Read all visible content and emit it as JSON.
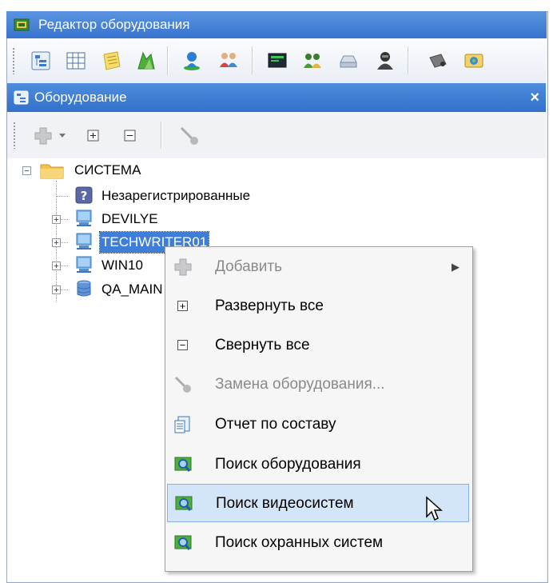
{
  "window": {
    "title": "Редактор оборудования"
  },
  "toolbar": {
    "buttons": [
      {
        "name": "tree-view-icon",
        "color": "#3a7bd5"
      },
      {
        "name": "grid-view-icon",
        "color": "#4a6fa8"
      },
      {
        "name": "notes-icon",
        "color": "#e8c84a"
      },
      {
        "name": "route-icon",
        "color": "#3b9b3b"
      },
      {
        "name": "user-location-icon",
        "color": "#2a7fd5"
      },
      {
        "name": "users-group-icon",
        "color": "#d8453b"
      },
      {
        "name": "monitor-icon",
        "color": "#1e2b36"
      },
      {
        "name": "people-icon",
        "color": "#3a7d2a"
      },
      {
        "name": "drive-icon",
        "color": "#7a8fa8"
      },
      {
        "name": "operator-icon",
        "color": "#333333"
      },
      {
        "name": "camera-icon",
        "color": "#6b6b6b"
      },
      {
        "name": "card-icon",
        "color": "#e2b443"
      }
    ]
  },
  "panel": {
    "title": "Оборудование",
    "close_label": "×"
  },
  "tree": {
    "root": "СИСТЕМА",
    "items": [
      {
        "label": "Незарегистрированные",
        "icon": "unregistered-icon"
      },
      {
        "label": "DEVILYE",
        "icon": "computer-icon"
      },
      {
        "label": "TECHWRITER01",
        "icon": "computer-icon",
        "selected": true
      },
      {
        "label": "WIN10",
        "icon": "computer-icon"
      },
      {
        "label": "QA_MAIN",
        "icon": "database-icon"
      }
    ]
  },
  "context_menu": {
    "items": [
      {
        "label": "Добавить",
        "disabled": true,
        "submenu": true
      },
      {
        "label": "Развернуть все"
      },
      {
        "label": "Свернуть все"
      },
      {
        "label": "Замена оборудования...",
        "disabled": true
      },
      {
        "label": "Отчет по составу"
      },
      {
        "label": "Поиск оборудования"
      },
      {
        "label": "Поиск видеосистем",
        "highlighted": true
      },
      {
        "label": "Поиск охранных систем"
      }
    ]
  },
  "colors": {
    "titlebar": "#3874cf",
    "selection": "#3f7ed8",
    "menu_highlight": "#d3e5f8"
  }
}
